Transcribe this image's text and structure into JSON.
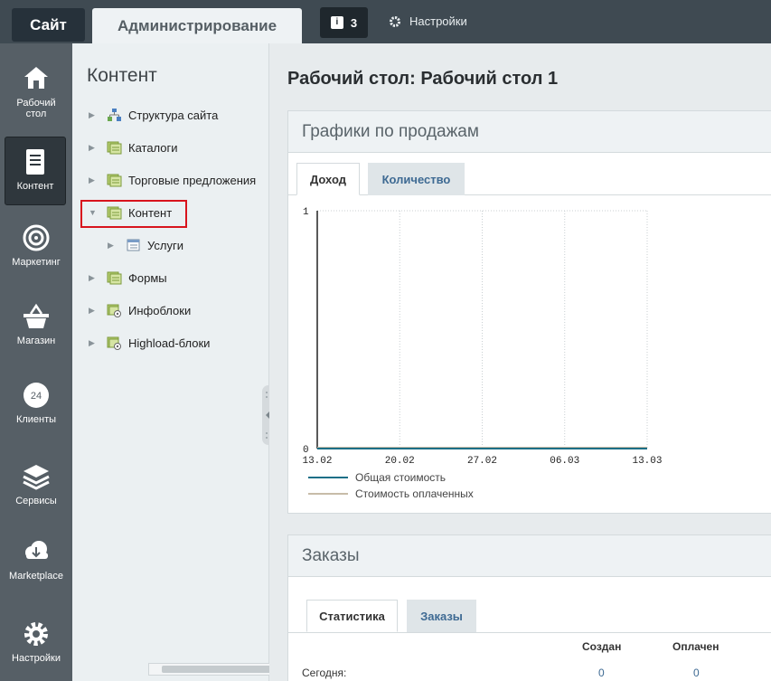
{
  "topbar": {
    "site_tab": "Сайт",
    "admin_tab": "Администрирование",
    "notifications_count": "3",
    "settings_label": "Настройки"
  },
  "iconbar": {
    "items": [
      {
        "label_line1": "Рабочий",
        "label_line2": "стол",
        "icon": "house-icon"
      },
      {
        "label_line1": "Контент",
        "label_line2": "",
        "icon": "document-icon"
      },
      {
        "label_line1": "Маркетинг",
        "label_line2": "",
        "icon": "target-icon"
      },
      {
        "label_line1": "Магазин",
        "label_line2": "",
        "icon": "basket-icon"
      },
      {
        "label_line1": "Клиенты",
        "label_line2": "",
        "icon": "clock-24-icon"
      },
      {
        "label_line1": "Сервисы",
        "label_line2": "",
        "icon": "layers-icon"
      },
      {
        "label_line1": "Marketplace",
        "label_line2": "",
        "icon": "cloud-download-icon"
      },
      {
        "label_line1": "Настройки",
        "label_line2": "",
        "icon": "gear-icon"
      }
    ]
  },
  "tree": {
    "title": "Контент",
    "items": [
      {
        "label": "Структура сайта",
        "icon": "sitemap-icon"
      },
      {
        "label": "Каталоги",
        "icon": "stack-icon"
      },
      {
        "label": "Торговые предложения",
        "icon": "stack-icon"
      },
      {
        "label": "Контент",
        "icon": "stack-icon"
      },
      {
        "label": "Услуги",
        "icon": "list-icon"
      },
      {
        "label": "Формы",
        "icon": "stack-icon"
      },
      {
        "label": "Инфоблоки",
        "icon": "stack-gear-icon"
      },
      {
        "label": "Highload-блоки",
        "icon": "stack-gear-icon"
      }
    ]
  },
  "main": {
    "title": "Рабочий стол: Рабочий стол 1",
    "sales_panel": {
      "title": "Графики по продажам",
      "tabs": [
        "Доход",
        "Количество"
      ]
    },
    "orders_panel": {
      "title": "Заказы",
      "tabs": [
        "Статистика",
        "Заказы"
      ],
      "columns": [
        "Создан",
        "Оплачен"
      ],
      "rows": [
        {
          "label": "Сегодня:",
          "created": "0",
          "paid": "0"
        }
      ]
    }
  },
  "colors": {
    "topbar": "#3f4a52",
    "iconbar": "#565f66",
    "highlight": "#d8141d",
    "series_total": "#1c6f87",
    "series_paid": "#c7bca8",
    "link": "#3e6a93"
  },
  "chart_data": {
    "type": "line",
    "x": [
      "13.02",
      "20.02",
      "27.02",
      "06.03",
      "13.03"
    ],
    "ylim": [
      0,
      1
    ],
    "yticks": [
      "1",
      "0"
    ],
    "grid": true,
    "legend": "bottom-left",
    "series": [
      {
        "name": "Общая стоимость",
        "values": [
          0,
          0,
          0,
          0,
          0
        ]
      },
      {
        "name": "Стоимость оплаченных",
        "values": [
          0,
          0,
          0,
          0,
          0
        ]
      }
    ]
  }
}
